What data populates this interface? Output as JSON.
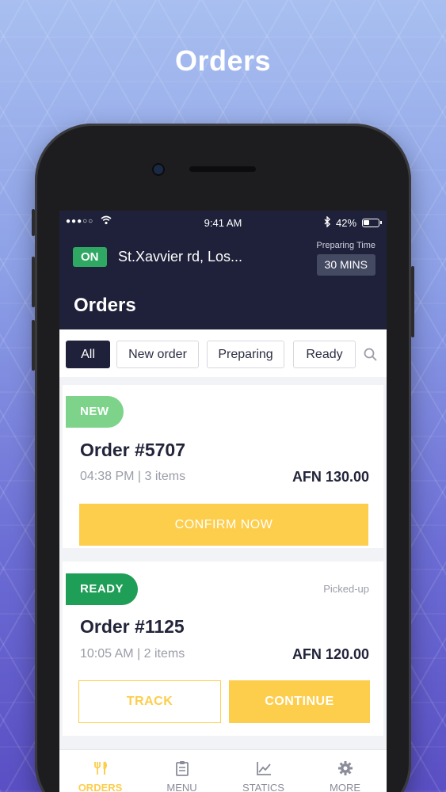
{
  "promo": {
    "title": "Orders"
  },
  "status_bar": {
    "signal": "●●●○○",
    "wifi": "wifi-icon",
    "time": "9:41 AM",
    "bluetooth": "bluetooth-icon",
    "battery": "42%"
  },
  "header": {
    "online_badge": "ON",
    "location": "St.Xavvier rd, Los...",
    "preparing_time_label": "Preparing Time",
    "preparing_time_value": "30 MINS",
    "title": "Orders"
  },
  "filters": [
    {
      "label": "All",
      "active": true
    },
    {
      "label": "New order",
      "active": false
    },
    {
      "label": "Preparing",
      "active": false
    },
    {
      "label": "Ready",
      "active": false
    }
  ],
  "orders": [
    {
      "status": "NEW",
      "status_color": "#7dd38a",
      "title": "Order #5707",
      "meta": "04:38 PM | 3 items",
      "amount": "AFN 130.00",
      "primary_action": "CONFIRM NOW"
    },
    {
      "status": "READY",
      "status_color": "#1f9e57",
      "note": "Picked-up",
      "title": "Order #1125",
      "meta": "10:05 AM | 2 items",
      "amount": "AFN 120.00",
      "secondary_action": "TRACK",
      "primary_action": "CONTINUE"
    }
  ],
  "bottom_nav": [
    {
      "label": "ORDERS",
      "icon": "fork-knife-icon",
      "active": true
    },
    {
      "label": "MENU",
      "icon": "clipboard-icon",
      "active": false
    },
    {
      "label": "STATICS",
      "icon": "chart-icon",
      "active": false
    },
    {
      "label": "MORE",
      "icon": "gear-icon",
      "active": false
    }
  ],
  "colors": {
    "accent": "#fdcd4c",
    "header": "#1e2139",
    "online": "#2ea862"
  }
}
